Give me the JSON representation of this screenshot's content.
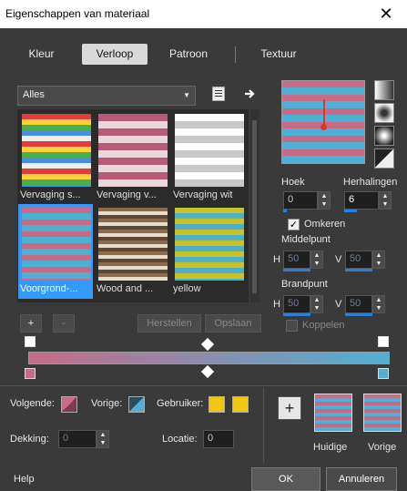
{
  "window": {
    "title": "Eigenschappen van materiaal",
    "close": "✕"
  },
  "tabs": [
    {
      "label": "Kleur"
    },
    {
      "label": "Verloop"
    },
    {
      "label": "Patroon"
    },
    {
      "label": "Textuur"
    }
  ],
  "library": {
    "category": "Alles",
    "items": [
      {
        "label": "Vervaging s..."
      },
      {
        "label": "Vervaging v..."
      },
      {
        "label": "Vervaging wit"
      },
      {
        "label": "Voorgrond-..."
      },
      {
        "label": "Wood and ..."
      },
      {
        "label": "yellow"
      }
    ],
    "selected_index": 3,
    "add": "+",
    "remove": "-",
    "restore": "Herstellen",
    "save": "Opslaan"
  },
  "settings": {
    "angle_label": "Hoek",
    "angle_value": "0",
    "repeats_label": "Herhalingen",
    "repeats_value": "6",
    "invert_label": "Omkeren",
    "invert_checked": true,
    "center_label": "Middelpunt",
    "center_h_label": "H",
    "center_h": "50",
    "center_v_label": "V",
    "center_v": "50",
    "focus_label": "Brandpunt",
    "focus_h_label": "H",
    "focus_h": "50",
    "focus_v_label": "V",
    "focus_v": "50",
    "link_label": "Koppelen",
    "link_checked": false
  },
  "colors": {
    "pink": "#c76b87",
    "blue": "#4fb0d6",
    "yellow": "#f0c814",
    "accent": "#3399ff"
  },
  "stops": {
    "next_label": "Volgende:",
    "prev_label": "Vorige:",
    "user_label": "Gebruiker:",
    "opacity_label": "Dekking:",
    "opacity_value": "0",
    "location_label": "Locatie:",
    "location_value": "0"
  },
  "compare": {
    "add": "+",
    "current_label": "Huidige",
    "previous_label": "Vorige"
  },
  "footer": {
    "help": "Help",
    "ok": "OK",
    "cancel": "Annuleren"
  },
  "icons": [
    "close-icon",
    "new-document-icon",
    "arrow-right-icon",
    "linear-gradient-icon",
    "rectangular-gradient-icon",
    "sunburst-gradient-icon",
    "radial-gradient-icon",
    "checkmark-icon",
    "spin-up-icon",
    "spin-down-icon",
    "stop-marker-icon",
    "midpoint-diamond-icon"
  ]
}
